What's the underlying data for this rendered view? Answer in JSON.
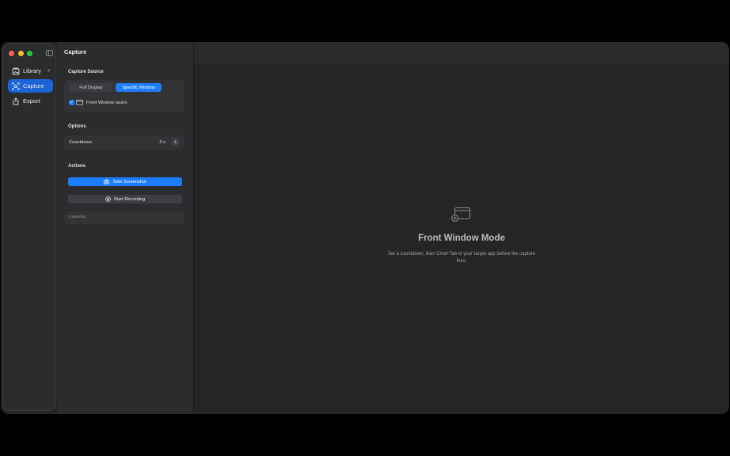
{
  "sidebar": {
    "items": [
      {
        "label": "Library",
        "icon": "photo-library-icon",
        "badge": "4"
      },
      {
        "label": "Capture",
        "icon": "capture-viewfinder-icon"
      },
      {
        "label": "Export",
        "icon": "share-export-icon"
      }
    ]
  },
  "panel": {
    "title": "Capture",
    "capture_source": {
      "title": "Capture Source",
      "options": [
        "Full Display",
        "Specific Window"
      ],
      "selected": "Specific Window",
      "checkbox_label": "Front Window (auto)",
      "checkbox_checked": true
    },
    "options": {
      "title": "Options",
      "countdown_label": "Countdown",
      "countdown_value": "3 s"
    },
    "actions": {
      "title": "Actions",
      "screenshot_label": "Take Screenshot",
      "record_label": "Start Recording"
    },
    "status": "Capturing..."
  },
  "main": {
    "empty_title": "Front Window Mode",
    "empty_description": "Set a countdown, then Cmd+Tab to your target app before the capture fires."
  },
  "colors": {
    "accent": "#1e7dff",
    "sidebar_active": "#1a64d6"
  }
}
